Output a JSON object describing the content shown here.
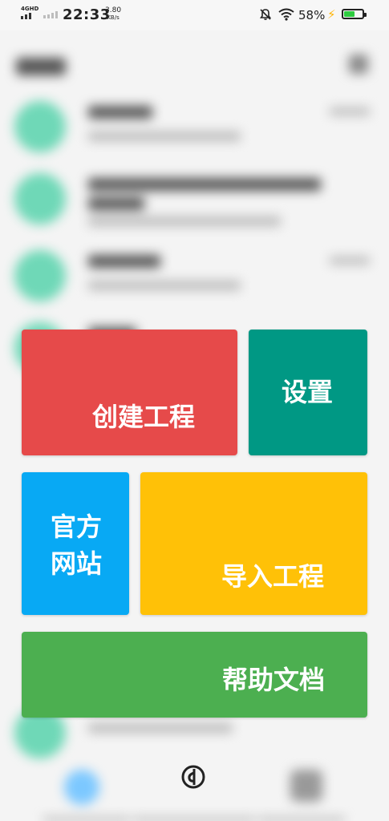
{
  "status_bar": {
    "network": "4GHD",
    "time": "22:33",
    "speed_value": "3.80",
    "speed_unit": "KB/s",
    "battery_percent": "58%",
    "battery_level": 0.58
  },
  "tiles": {
    "create_project": "创建工程",
    "settings": "设置",
    "website_line1": "官方",
    "website_line2": "网站",
    "import_project": "导入工程",
    "help_docs": "帮助文档"
  },
  "colors": {
    "create_project": "#e64a4a",
    "settings": "#009884",
    "website": "#08a9f4",
    "import_project": "#ffc107",
    "help_docs": "#4caf50",
    "background_avatar": "#6fd8b7"
  },
  "icons": {
    "status": [
      "mute-icon",
      "wifi-icon",
      "charging-icon",
      "battery-icon"
    ],
    "center": "app-logo-icon"
  }
}
